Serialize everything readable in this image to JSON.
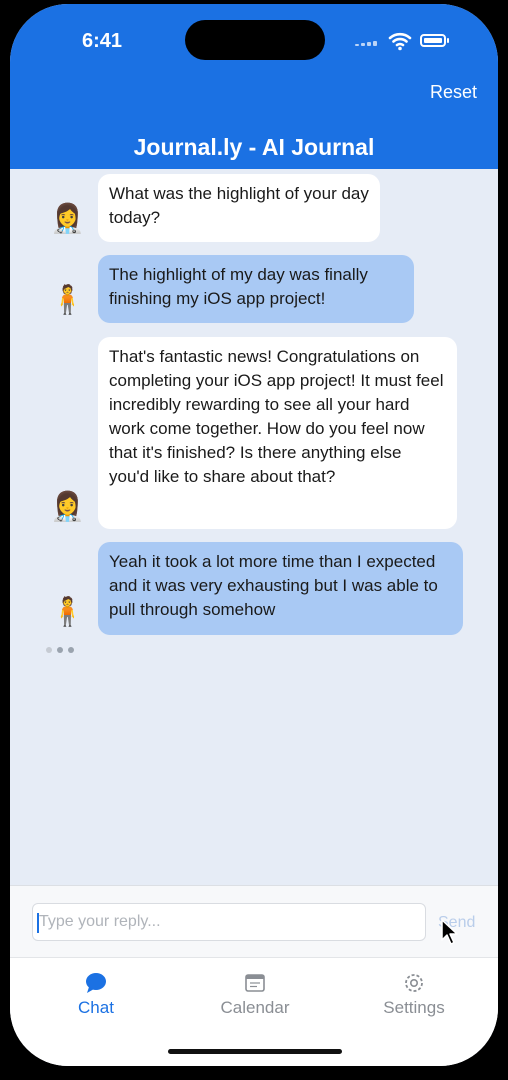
{
  "status_bar": {
    "time": "6:41"
  },
  "header": {
    "title": "Journal.ly - AI Journal",
    "reset_label": "Reset",
    "background": "#1b71e3"
  },
  "messages": [
    {
      "role": "ai",
      "avatar": "👩‍⚕️",
      "text": "What was the highlight of your day today?"
    },
    {
      "role": "user",
      "avatar": "🧍",
      "text": "The highlight of my day was finally finishing my iOS app project!"
    },
    {
      "role": "ai",
      "avatar": "👩‍⚕️",
      "text": "That's fantastic news! Congratulations on completing your iOS app project! It must feel incredibly rewarding to see all your hard work come together. How do you feel now that it's finished? Is there anything else you'd like to share about that?"
    },
    {
      "role": "user",
      "avatar": "🧍",
      "text": "Yeah it took a lot more time than I expected and it was very exhausting but I was able to pull through somehow"
    }
  ],
  "composer": {
    "placeholder": "Type your reply...",
    "send_label": "Send"
  },
  "tabs": [
    {
      "label": "Chat",
      "icon": "chat-bubble-icon",
      "active": true
    },
    {
      "label": "Calendar",
      "icon": "calendar-icon",
      "active": false
    },
    {
      "label": "Settings",
      "icon": "gear-icon",
      "active": false
    }
  ],
  "colors": {
    "accent": "#1b71e3",
    "user_bubble": "#a9c9f4",
    "ai_bubble": "#ffffff",
    "chat_bg": "#e6ecf6"
  }
}
